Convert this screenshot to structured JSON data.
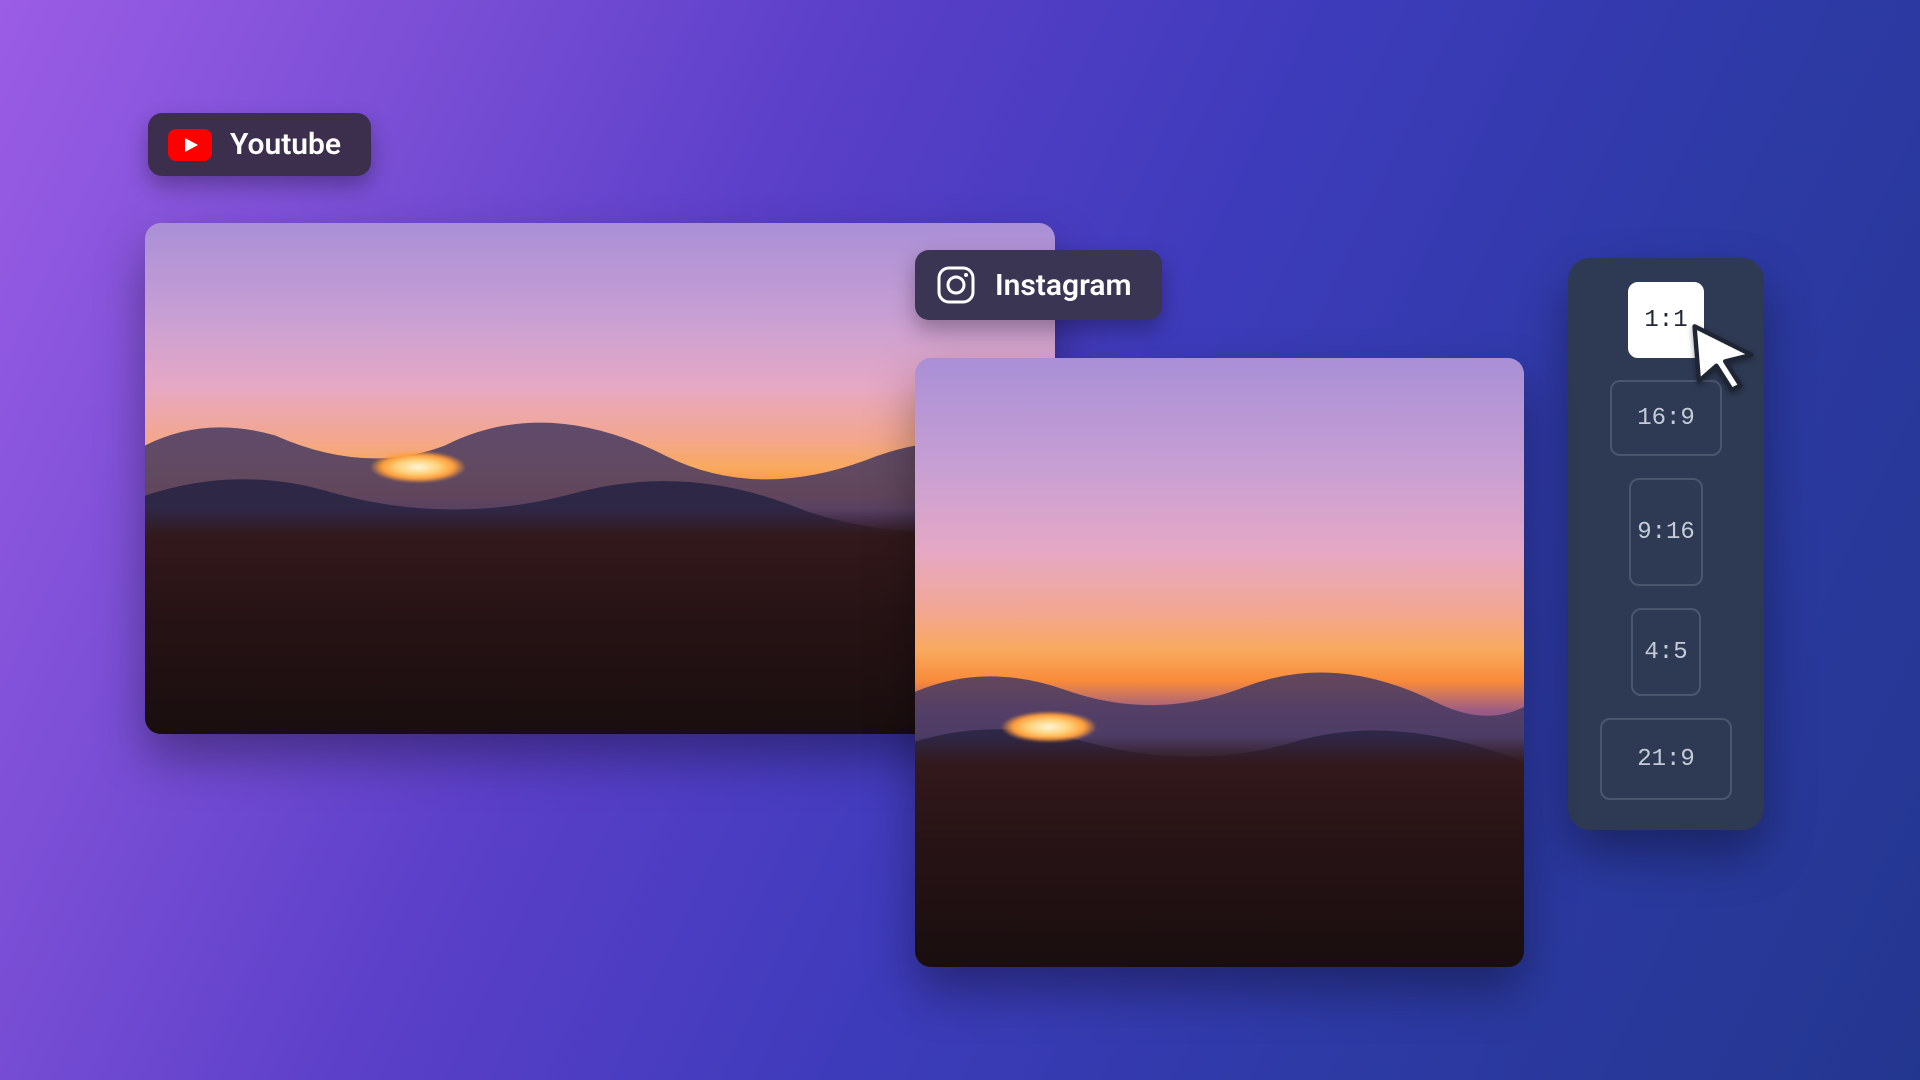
{
  "chips": {
    "youtube": {
      "label": "Youtube"
    },
    "instagram": {
      "label": "Instagram"
    }
  },
  "aspect_panel": {
    "options": [
      {
        "label": "1:1",
        "active": true
      },
      {
        "label": "16:9",
        "active": false
      },
      {
        "label": "9:16",
        "active": false
      },
      {
        "label": "4:5",
        "active": false
      },
      {
        "label": "21:9",
        "active": false
      }
    ]
  }
}
